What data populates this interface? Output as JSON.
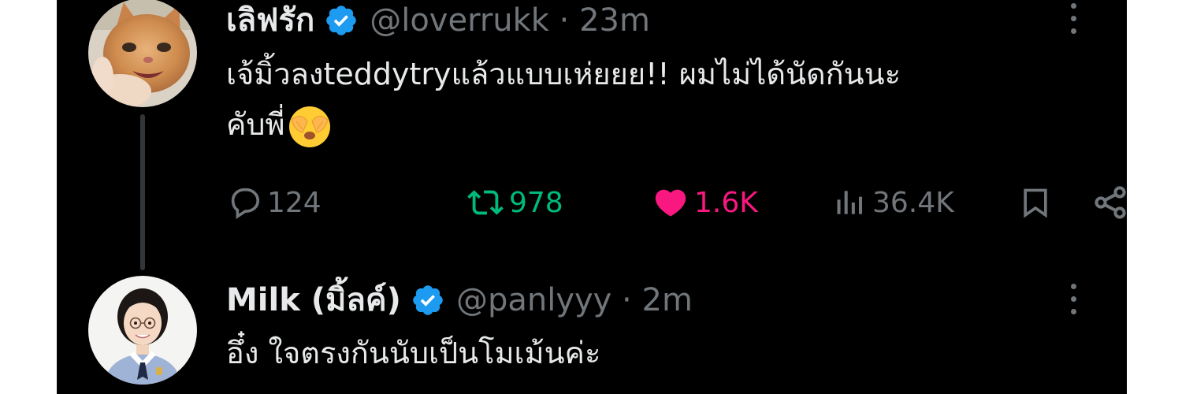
{
  "tweets": [
    {
      "display_name": "เลิฟรัก",
      "handle": "@loverrukk",
      "time": "23m",
      "text_line1": "เจ้มิ้วลงteddytryแล้วแบบเห่ยยย!! ผมไม่ได้นัดกันนะ",
      "text_line2": "คับพี่",
      "emoji": "see-no-evil-face",
      "verified": true,
      "avatar": "orange-kitten-photo"
    },
    {
      "display_name": "Milk (มิ้ลค์)",
      "handle": "@panlyyy",
      "time": "2m",
      "text_line1": "อึ๋ง ใจตรงกันนับเป็นโมเม้นค่ะ",
      "verified": true,
      "avatar": "girl-in-school-uniform-photo"
    }
  ],
  "actions": {
    "replies": "124",
    "retweets": "978",
    "likes": "1.6K",
    "views": "36.4K"
  },
  "colors": {
    "background": "#000000",
    "text": "#e7e9ea",
    "muted": "#71767b",
    "retweet_green": "#00ba7c",
    "like_pink": "#f91880",
    "verified_blue": "#1d9bf0"
  }
}
